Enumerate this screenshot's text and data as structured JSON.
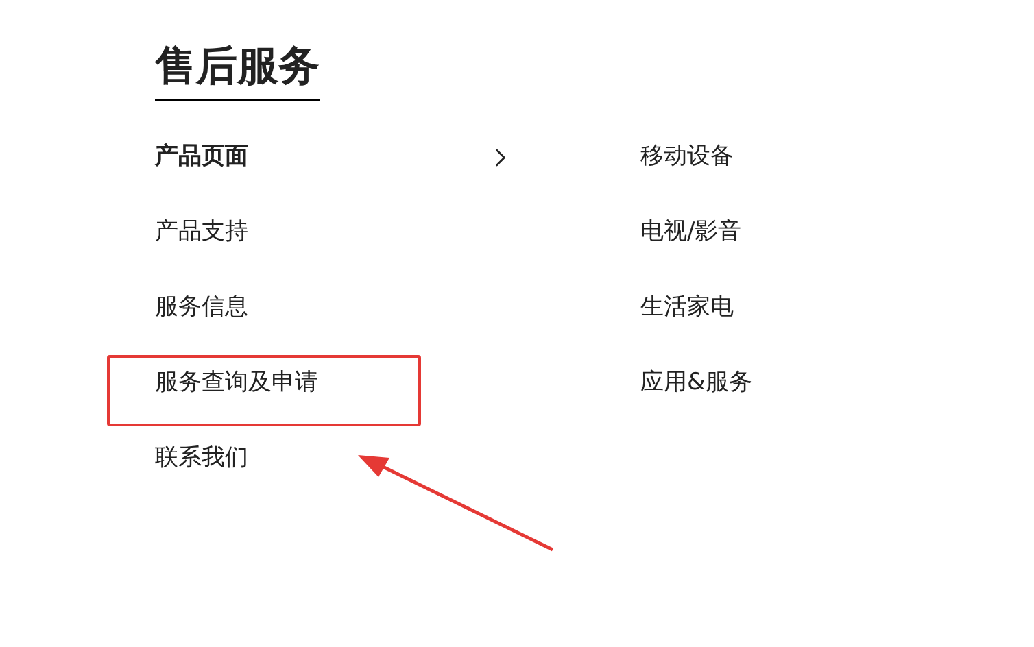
{
  "title": "售后服务",
  "menu": [
    {
      "label": "产品页面",
      "selected": true,
      "highlighted": false
    },
    {
      "label": "产品支持",
      "selected": false,
      "highlighted": false
    },
    {
      "label": "服务信息",
      "selected": false,
      "highlighted": false
    },
    {
      "label": "服务查询及申请",
      "selected": false,
      "highlighted": true
    },
    {
      "label": "联系我们",
      "selected": false,
      "highlighted": false
    }
  ],
  "submenu": [
    {
      "label": "移动设备"
    },
    {
      "label": "电视/影音"
    },
    {
      "label": "生活家电"
    },
    {
      "label": "应用&服务"
    }
  ]
}
